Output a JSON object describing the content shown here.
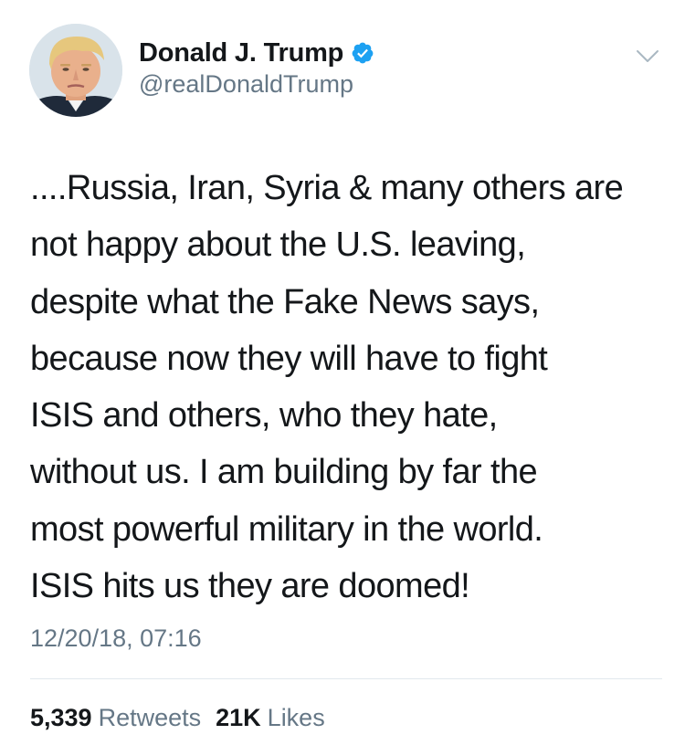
{
  "tweet": {
    "author": {
      "display_name": "Donald J. Trump",
      "handle": "@realDonaldTrump",
      "verified": true,
      "avatar_icon": "profile-photo"
    },
    "menu_icon": "chevron-down-icon",
    "text_lines": [
      "....Russia, Iran, Syria & many others are",
      "not happy about the U.S. leaving,",
      "despite what the Fake News says,",
      "because now they will have to fight",
      "ISIS and others, who they hate,",
      "without us. I am building by far the",
      "most powerful military in the world.",
      "ISIS hits us they are doomed!"
    ],
    "timestamp": "12/20/18, 07:16",
    "stats": {
      "retweets_count": "5,339",
      "retweets_label": "Retweets",
      "likes_count": "21K",
      "likes_label": "Likes"
    }
  },
  "colors": {
    "text_primary": "#14171a",
    "text_secondary": "#657786",
    "verified_blue": "#1da1f2",
    "divider": "#e1e8ed"
  }
}
